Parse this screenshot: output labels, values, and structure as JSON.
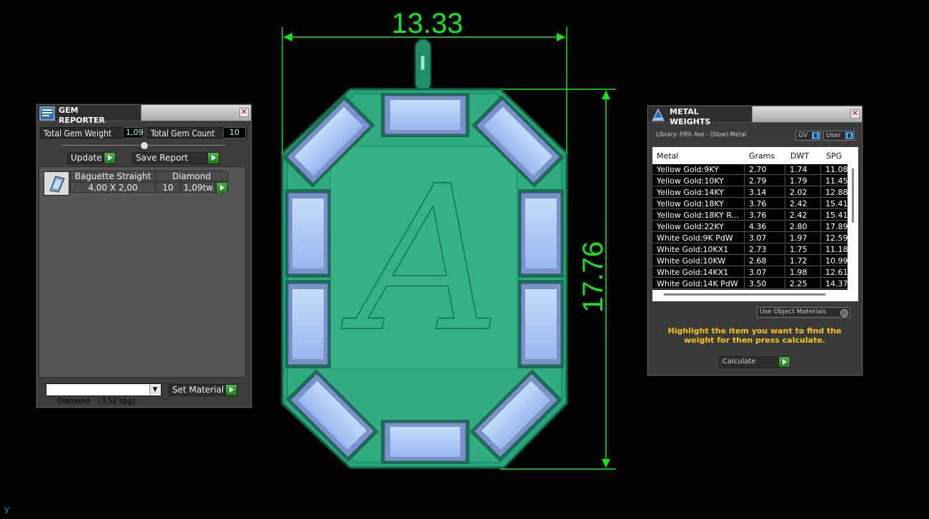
{
  "viewport": {
    "dimension_width": "13.33",
    "dimension_height": "17.76",
    "engraved_letter": "A",
    "axis_label": "y"
  },
  "gem_reporter": {
    "title": "GEM REPORTER",
    "total_weight_label": "Total Gem Weight",
    "total_weight_value": "1,09",
    "total_count_label": "Total Gem Count",
    "total_count_value": "10",
    "update_label": "Update",
    "save_report_label": "Save Report",
    "gem": {
      "shape": "Baguette Straight",
      "material": "Diamond",
      "size": "4,00 X 2,00",
      "count": "10",
      "weight": "1,09tw"
    },
    "material_select": "Diamond    (3,52 spg)",
    "set_material_label": "Set Material"
  },
  "metal_weights": {
    "title": "METAL WEIGHTS",
    "library": "Library: Fifth Ave - (Slow)-Metal",
    "toggle_gv": "GV",
    "toggle_user": "User",
    "columns": [
      "Metal",
      "Grams",
      "DWT",
      "SPG"
    ],
    "rows": [
      [
        "Yellow Gold:9KY",
        "2.70",
        "1.74",
        "11.08"
      ],
      [
        "Yellow Gold:10KY",
        "2.79",
        "1.79",
        "11.45"
      ],
      [
        "Yellow Gold:14KY",
        "3.14",
        "2.02",
        "12.88"
      ],
      [
        "Yellow Gold:18KY",
        "3.76",
        "2.42",
        "15.41"
      ],
      [
        "Yellow Gold:18KY R...",
        "3.76",
        "2.42",
        "15.41"
      ],
      [
        "Yellow Gold:22KY",
        "4.36",
        "2.80",
        "17.89"
      ],
      [
        "White Gold:9K PdW",
        "3.07",
        "1.97",
        "12.59"
      ],
      [
        "White Gold:10KX1",
        "2.73",
        "1.75",
        "11.18"
      ],
      [
        "White Gold:10KW",
        "2.68",
        "1.72",
        "10.99"
      ],
      [
        "White Gold:14KX1",
        "3.07",
        "1.98",
        "12.61"
      ],
      [
        "White Gold:14K PdW",
        "3.50",
        "2.25",
        "14.37"
      ]
    ],
    "use_object_materials": "Use Object Materials",
    "hint": "Highlight the item you want to find the weight for then press calculate.",
    "calculate_label": "Calculate",
    "hint_color": "#f5c518"
  },
  "colors": {
    "dimension": "#19e619",
    "pendant": "#2aa57a",
    "stone": "#a9c8f5"
  }
}
